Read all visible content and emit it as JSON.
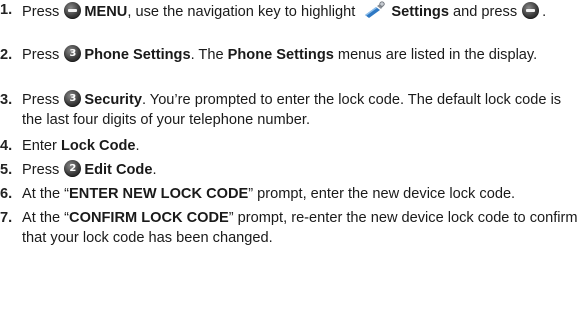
{
  "keys": {
    "step3": "3",
    "step5": "2"
  },
  "steps": [
    {
      "num": "1.",
      "t1": "Press ",
      "t2": "MENU",
      "t3": ", use the navigation key to highlight ",
      "t4": "Settings",
      "t5": " and press ",
      "t6": "."
    },
    {
      "num": "2.",
      "t1": "Press ",
      "t2": "Phone Settings",
      "t3": ". The ",
      "t4": "Phone Settings",
      "t5": " menus are listed in the display."
    },
    {
      "num": "3.",
      "t1": "Press ",
      "t2": "Security",
      "t3": ". You’re prompted to enter the lock code. The default lock code is the last four digits of your telephone number."
    },
    {
      "num": "4.",
      "t1": "Enter ",
      "t2": "Lock Code",
      "t3": "."
    },
    {
      "num": "5.",
      "t1": "Press ",
      "t2": "Edit Code",
      "t3": "."
    },
    {
      "num": "6.",
      "t1": "At the “",
      "t2": "ENTER NEW LOCK CODE",
      "t3": "” prompt, enter the new device lock code."
    },
    {
      "num": "7.",
      "t1": "At the “",
      "t2": "CONFIRM LOCK CODE",
      "t3": "” prompt, re-enter the new device lock code to confirm that your lock code has been changed."
    }
  ]
}
